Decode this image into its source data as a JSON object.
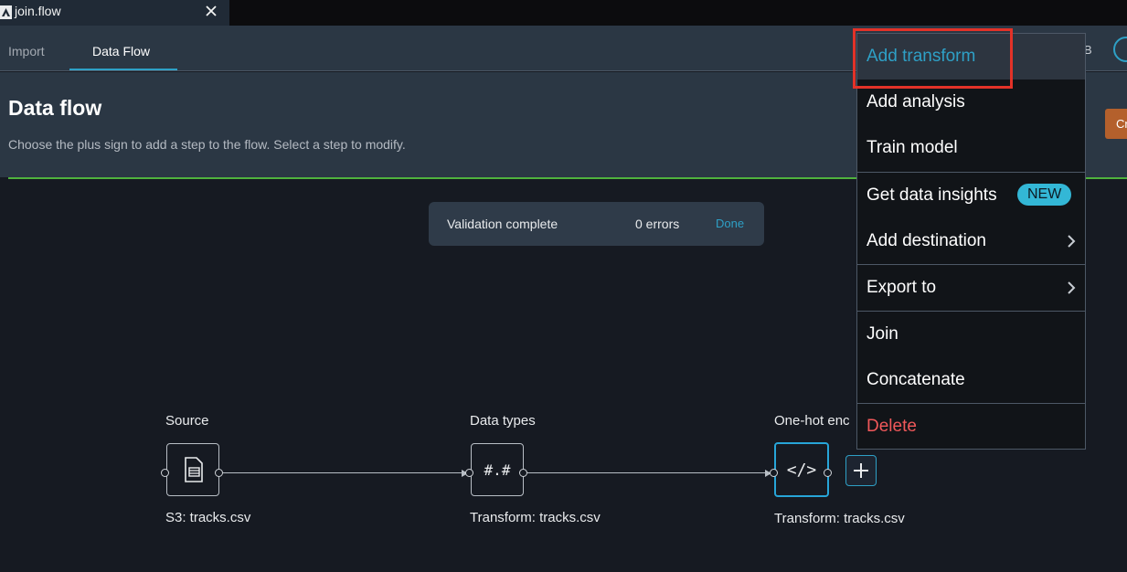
{
  "window": {
    "file_tab": "join.flow"
  },
  "nav": {
    "tabs": [
      "Import",
      "Data Flow"
    ],
    "active_tab": "Data Flow",
    "right_text": "B"
  },
  "header": {
    "title": "Data flow",
    "subtitle": "Choose the plus sign to add a step to the flow. Select a step to modify.",
    "button_partial": "Cr"
  },
  "toast": {
    "message": "Validation complete",
    "errors": "0 errors",
    "action": "Done"
  },
  "nodes": [
    {
      "title": "Source",
      "subtitle": "S3: tracks.csv",
      "icon": "document-icon"
    },
    {
      "title": "Data types",
      "subtitle": "Transform: tracks.csv",
      "icon": "#.#"
    },
    {
      "title": "One-hot enc",
      "subtitle": "Transform: tracks.csv",
      "icon": "</>"
    }
  ],
  "menu": {
    "items": [
      {
        "label": "Add transform",
        "state": "hover",
        "highlighted": true
      },
      {
        "label": "Add analysis"
      },
      {
        "label": "Train model"
      },
      {
        "label": "Get data insights",
        "badge": "NEW"
      },
      {
        "label": "Add destination",
        "submenu": true
      },
      {
        "label": "Export to",
        "submenu": true
      },
      {
        "label": "Join"
      },
      {
        "label": "Concatenate"
      },
      {
        "label": "Delete",
        "danger": true
      }
    ]
  },
  "colors": {
    "accent": "#2ea0c6",
    "danger": "#f0585a",
    "highlight": "#e33228",
    "badge": "#33b7d6"
  }
}
